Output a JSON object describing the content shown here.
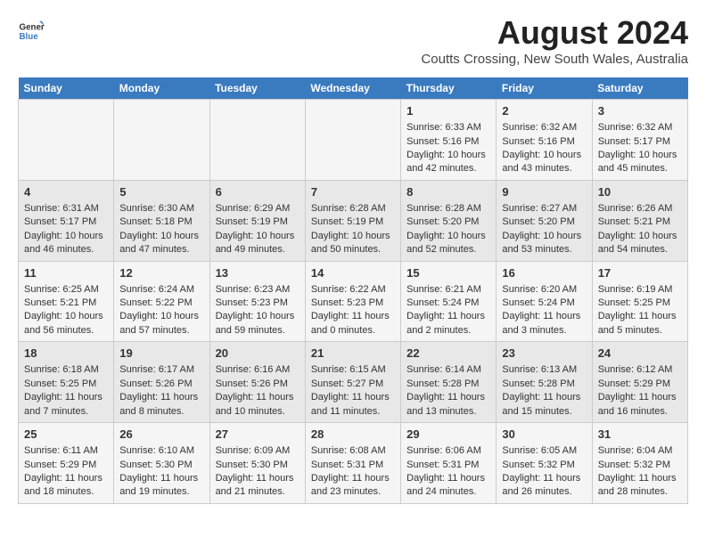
{
  "header": {
    "logo_line1": "General",
    "logo_line2": "Blue",
    "month_title": "August 2024",
    "location": "Coutts Crossing, New South Wales, Australia"
  },
  "weekdays": [
    "Sunday",
    "Monday",
    "Tuesday",
    "Wednesday",
    "Thursday",
    "Friday",
    "Saturday"
  ],
  "weeks": [
    [
      {
        "day": "",
        "content": ""
      },
      {
        "day": "",
        "content": ""
      },
      {
        "day": "",
        "content": ""
      },
      {
        "day": "",
        "content": ""
      },
      {
        "day": "1",
        "content": "Sunrise: 6:33 AM\nSunset: 5:16 PM\nDaylight: 10 hours\nand 42 minutes."
      },
      {
        "day": "2",
        "content": "Sunrise: 6:32 AM\nSunset: 5:16 PM\nDaylight: 10 hours\nand 43 minutes."
      },
      {
        "day": "3",
        "content": "Sunrise: 6:32 AM\nSunset: 5:17 PM\nDaylight: 10 hours\nand 45 minutes."
      }
    ],
    [
      {
        "day": "4",
        "content": "Sunrise: 6:31 AM\nSunset: 5:17 PM\nDaylight: 10 hours\nand 46 minutes."
      },
      {
        "day": "5",
        "content": "Sunrise: 6:30 AM\nSunset: 5:18 PM\nDaylight: 10 hours\nand 47 minutes."
      },
      {
        "day": "6",
        "content": "Sunrise: 6:29 AM\nSunset: 5:19 PM\nDaylight: 10 hours\nand 49 minutes."
      },
      {
        "day": "7",
        "content": "Sunrise: 6:28 AM\nSunset: 5:19 PM\nDaylight: 10 hours\nand 50 minutes."
      },
      {
        "day": "8",
        "content": "Sunrise: 6:28 AM\nSunset: 5:20 PM\nDaylight: 10 hours\nand 52 minutes."
      },
      {
        "day": "9",
        "content": "Sunrise: 6:27 AM\nSunset: 5:20 PM\nDaylight: 10 hours\nand 53 minutes."
      },
      {
        "day": "10",
        "content": "Sunrise: 6:26 AM\nSunset: 5:21 PM\nDaylight: 10 hours\nand 54 minutes."
      }
    ],
    [
      {
        "day": "11",
        "content": "Sunrise: 6:25 AM\nSunset: 5:21 PM\nDaylight: 10 hours\nand 56 minutes."
      },
      {
        "day": "12",
        "content": "Sunrise: 6:24 AM\nSunset: 5:22 PM\nDaylight: 10 hours\nand 57 minutes."
      },
      {
        "day": "13",
        "content": "Sunrise: 6:23 AM\nSunset: 5:23 PM\nDaylight: 10 hours\nand 59 minutes."
      },
      {
        "day": "14",
        "content": "Sunrise: 6:22 AM\nSunset: 5:23 PM\nDaylight: 11 hours\nand 0 minutes."
      },
      {
        "day": "15",
        "content": "Sunrise: 6:21 AM\nSunset: 5:24 PM\nDaylight: 11 hours\nand 2 minutes."
      },
      {
        "day": "16",
        "content": "Sunrise: 6:20 AM\nSunset: 5:24 PM\nDaylight: 11 hours\nand 3 minutes."
      },
      {
        "day": "17",
        "content": "Sunrise: 6:19 AM\nSunset: 5:25 PM\nDaylight: 11 hours\nand 5 minutes."
      }
    ],
    [
      {
        "day": "18",
        "content": "Sunrise: 6:18 AM\nSunset: 5:25 PM\nDaylight: 11 hours\nand 7 minutes."
      },
      {
        "day": "19",
        "content": "Sunrise: 6:17 AM\nSunset: 5:26 PM\nDaylight: 11 hours\nand 8 minutes."
      },
      {
        "day": "20",
        "content": "Sunrise: 6:16 AM\nSunset: 5:26 PM\nDaylight: 11 hours\nand 10 minutes."
      },
      {
        "day": "21",
        "content": "Sunrise: 6:15 AM\nSunset: 5:27 PM\nDaylight: 11 hours\nand 11 minutes."
      },
      {
        "day": "22",
        "content": "Sunrise: 6:14 AM\nSunset: 5:28 PM\nDaylight: 11 hours\nand 13 minutes."
      },
      {
        "day": "23",
        "content": "Sunrise: 6:13 AM\nSunset: 5:28 PM\nDaylight: 11 hours\nand 15 minutes."
      },
      {
        "day": "24",
        "content": "Sunrise: 6:12 AM\nSunset: 5:29 PM\nDaylight: 11 hours\nand 16 minutes."
      }
    ],
    [
      {
        "day": "25",
        "content": "Sunrise: 6:11 AM\nSunset: 5:29 PM\nDaylight: 11 hours\nand 18 minutes."
      },
      {
        "day": "26",
        "content": "Sunrise: 6:10 AM\nSunset: 5:30 PM\nDaylight: 11 hours\nand 19 minutes."
      },
      {
        "day": "27",
        "content": "Sunrise: 6:09 AM\nSunset: 5:30 PM\nDaylight: 11 hours\nand 21 minutes."
      },
      {
        "day": "28",
        "content": "Sunrise: 6:08 AM\nSunset: 5:31 PM\nDaylight: 11 hours\nand 23 minutes."
      },
      {
        "day": "29",
        "content": "Sunrise: 6:06 AM\nSunset: 5:31 PM\nDaylight: 11 hours\nand 24 minutes."
      },
      {
        "day": "30",
        "content": "Sunrise: 6:05 AM\nSunset: 5:32 PM\nDaylight: 11 hours\nand 26 minutes."
      },
      {
        "day": "31",
        "content": "Sunrise: 6:04 AM\nSunset: 5:32 PM\nDaylight: 11 hours\nand 28 minutes."
      }
    ]
  ]
}
